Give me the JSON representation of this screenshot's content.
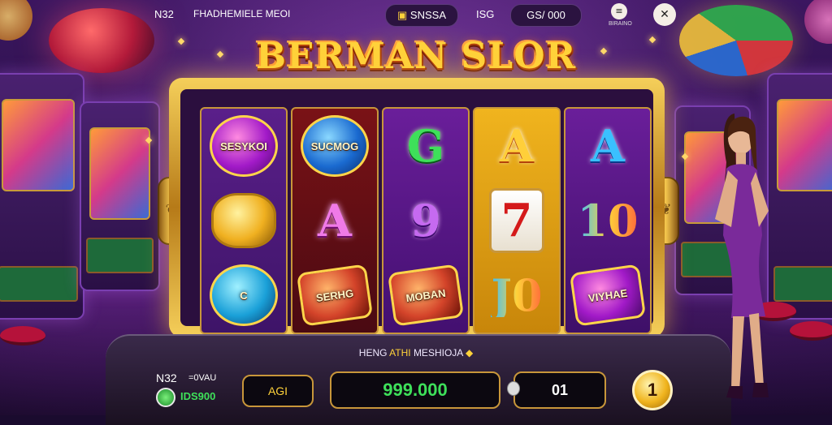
{
  "top_bar": {
    "left_id": "N32",
    "left_text": "FHADHEMIELE MEOI",
    "coin_pill": "SNSSA",
    "center_value": "ISG",
    "balance_pill": "GS/ 000",
    "menu_button_caption": "BIRAINO",
    "menu_icon": "menu-icon",
    "close_icon": "close-icon"
  },
  "title": "BERMAN SLOR",
  "reels": [
    [
      {
        "type": "chip",
        "style": "purple",
        "text": "SESYKOI"
      },
      {
        "type": "chip",
        "style": "gold coin",
        "text": ""
      },
      {
        "type": "chip",
        "style": "teal",
        "text": "C"
      }
    ],
    [
      {
        "type": "chip",
        "style": "blue",
        "text": "SUCMOG"
      },
      {
        "type": "glyph",
        "style": "g-pink",
        "text": "A"
      },
      {
        "type": "chip",
        "style": "red badge",
        "text": "SERHG"
      }
    ],
    [
      {
        "type": "glyph",
        "style": "g-green",
        "text": "G"
      },
      {
        "type": "glyph",
        "style": "g-violet",
        "text": "9"
      },
      {
        "type": "chip",
        "style": "red badge",
        "text": "MOBAN"
      }
    ],
    [
      {
        "type": "glyph",
        "style": "g-orange",
        "text": "A"
      },
      {
        "type": "seven",
        "style": "",
        "text": "7"
      },
      {
        "type": "glyph",
        "style": "g-multi",
        "text": "J0"
      }
    ],
    [
      {
        "type": "glyph",
        "style": "g-cyan",
        "text": "A"
      },
      {
        "type": "glyph",
        "style": "g-multi",
        "text": "10"
      },
      {
        "type": "chip",
        "style": "purple badge",
        "text": "VIYHAE"
      }
    ]
  ],
  "info_line": {
    "prefix": "HENG",
    "highlight": "ATHI",
    "suffix": "MESHIOJA"
  },
  "bottom": {
    "id_label": "N32",
    "bet_label": "=0VAU",
    "coin_value": "IDS900",
    "auto_button": "AGI",
    "credit_value": "999.000",
    "line_value": "01",
    "spin_coin": "1"
  },
  "colors": {
    "accent": "#ffd23a",
    "credit_green": "#3ee05a",
    "frame_gold": "#c8963a"
  }
}
